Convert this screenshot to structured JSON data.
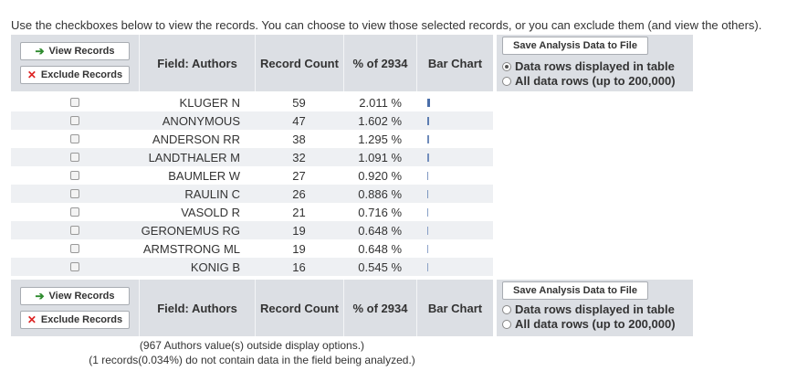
{
  "intro_text": "Use the checkboxes below to view the records. You can choose to view those selected records, or you can exclude them (and view the others).",
  "buttons": {
    "view_records": "View Records",
    "exclude_records": "Exclude Records",
    "save_analysis": "Save Analysis Data to File"
  },
  "columns": {
    "field": "Field: Authors",
    "record_count": "Record Count",
    "percent": "% of 2934",
    "bar_chart": "Bar Chart"
  },
  "radio": {
    "displayed": "Data rows displayed in table",
    "all": "All data rows (up to 200,000)",
    "top_selected": "displayed",
    "bottom_selected": "none"
  },
  "rows": [
    {
      "author": "KLUGER N",
      "count": "59",
      "percent": "2.011 %",
      "fraction": 0.02011
    },
    {
      "author": "ANONYMOUS",
      "count": "47",
      "percent": "1.602 %",
      "fraction": 0.01602
    },
    {
      "author": "ANDERSON RR",
      "count": "38",
      "percent": "1.295 %",
      "fraction": 0.01295
    },
    {
      "author": "LANDTHALER M",
      "count": "32",
      "percent": "1.091 %",
      "fraction": 0.01091
    },
    {
      "author": "BAUMLER W",
      "count": "27",
      "percent": "0.920 %",
      "fraction": 0.0092
    },
    {
      "author": "RAULIN C",
      "count": "26",
      "percent": "0.886 %",
      "fraction": 0.00886
    },
    {
      "author": "VASOLD R",
      "count": "21",
      "percent": "0.716 %",
      "fraction": 0.00716
    },
    {
      "author": "GERONEMUS RG",
      "count": "19",
      "percent": "0.648 %",
      "fraction": 0.00648
    },
    {
      "author": "ARMSTRONG ML",
      "count": "19",
      "percent": "0.648 %",
      "fraction": 0.00648
    },
    {
      "author": "KONIG B",
      "count": "16",
      "percent": "0.545 %",
      "fraction": 0.00545
    }
  ],
  "notes": {
    "outside": "(967 Authors value(s) outside display options.)",
    "missing": "(1 records(0.034%) do not contain data in the field being analyzed.)"
  },
  "colors": {
    "header_bg": "#dcdfe4",
    "bar": "#4a6ea9",
    "view_arrow": "#2d8a2d",
    "exclude_x": "#dd2222"
  }
}
